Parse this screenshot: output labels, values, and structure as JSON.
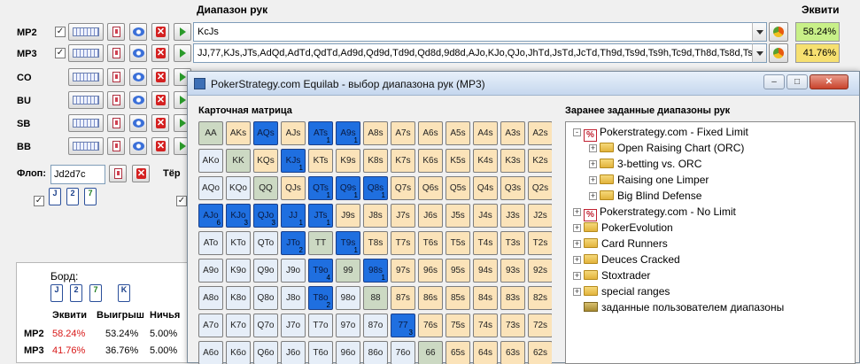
{
  "main": {
    "range_header": "Диапазон рук",
    "equity_header": "Эквити",
    "players": [
      {
        "label": "MP2",
        "checked": "✓",
        "range": "KcJs",
        "equity": "58.24%",
        "equity_color": "#c8f088"
      },
      {
        "label": "MP3",
        "checked": "✓",
        "range": "JJ,77,KJs,JTs,AdQd,AdTd,QdTd,Ad9d,Qd9d,Td9d,Qd8d,9d8d,AJo,KJo,QJo,JhTd,JsTd,JcTd,Th9d,Ts9d,Ts9h,Tc9d,Th8d,Ts8d,Ts",
        "equity": "41.76%",
        "equity_color": "#f6e070"
      },
      {
        "label": "CO"
      },
      {
        "label": "BU"
      },
      {
        "label": "SB"
      },
      {
        "label": "BB"
      }
    ],
    "flop_label": "Флоп:",
    "flop_value": "Jd2d7c",
    "turn_label": "Тёр",
    "flop_cards": [
      "J",
      "2",
      "7"
    ],
    "flop_check": "✓",
    "turn_check": "✓"
  },
  "results": {
    "board_label": "Борд:",
    "board_cards": [
      "J",
      "2",
      "7",
      "K"
    ],
    "col_equity": "Эквити",
    "col_win": "Выигрыш",
    "col_tie": "Ничья",
    "rows": [
      {
        "player": "MP2",
        "equity": "58.24%",
        "win": "53.24%",
        "tie": "5.00%"
      },
      {
        "player": "MP3",
        "equity": "41.76%",
        "win": "36.76%",
        "tie": "5.00%"
      }
    ],
    "equity_text_color": "#d81818"
  },
  "dialog": {
    "title": "PokerStrategy.com Equilab - выбор диапазона рук (MP3)",
    "min_glyph": "–",
    "max_glyph": "□",
    "close_glyph": "✕",
    "matrix_title": "Карточная матрица",
    "preset_title": "Заранее заданные диапазоны рук",
    "matrix_rows": [
      [
        "AA",
        "AKs",
        "AQs",
        "AJs",
        "ATs",
        "A9s",
        "A8s",
        "A7s",
        "A6s",
        "A5s",
        "A4s",
        "A3s",
        "A2s"
      ],
      [
        "AKo",
        "KK",
        "KQs",
        "KJs",
        "KTs",
        "K9s",
        "K8s",
        "K7s",
        "K6s",
        "K5s",
        "K4s",
        "K3s",
        "K2s"
      ],
      [
        "AQo",
        "KQo",
        "QQ",
        "QJs",
        "QTs",
        "Q9s",
        "Q8s",
        "Q7s",
        "Q6s",
        "Q5s",
        "Q4s",
        "Q3s",
        "Q2s"
      ],
      [
        "AJo",
        "KJo",
        "QJo",
        "JJ",
        "JTs",
        "J9s",
        "J8s",
        "J7s",
        "J6s",
        "J5s",
        "J4s",
        "J3s",
        "J2s"
      ],
      [
        "ATo",
        "KTo",
        "QTo",
        "JTo",
        "TT",
        "T9s",
        "T8s",
        "T7s",
        "T6s",
        "T5s",
        "T4s",
        "T3s",
        "T2s"
      ],
      [
        "A9o",
        "K9o",
        "Q9o",
        "J9o",
        "T9o",
        "99",
        "98s",
        "97s",
        "96s",
        "95s",
        "94s",
        "93s",
        "92s"
      ],
      [
        "A8o",
        "K8o",
        "Q8o",
        "J8o",
        "T8o",
        "98o",
        "88",
        "87s",
        "86s",
        "85s",
        "84s",
        "83s",
        "82s"
      ],
      [
        "A7o",
        "K7o",
        "Q7o",
        "J7o",
        "T7o",
        "97o",
        "87o",
        "77",
        "76s",
        "75s",
        "74s",
        "73s",
        "72s"
      ],
      [
        "A6o",
        "K6o",
        "Q6o",
        "J6o",
        "T6o",
        "96o",
        "86o",
        "76o",
        "66",
        "65s",
        "64s",
        "63s",
        "62s"
      ]
    ],
    "selected_cells": {
      "AQs": "",
      "ATs": "1",
      "A9s": "1",
      "KJs": "1",
      "QTs": "1",
      "Q9s": "1",
      "Q8s": "1",
      "AJo": "6",
      "KJo": "3",
      "QJo": "3",
      "JJ": "1",
      "JTs": "1",
      "JTo": "2",
      "T9s": "1",
      "T9o": "4",
      "98s": "1",
      "T8o": "2",
      "77": "3"
    },
    "tree": [
      {
        "level": 0,
        "kind": "ps",
        "expander": "-",
        "label": "Pokerstrategy.com - Fixed Limit"
      },
      {
        "level": 1,
        "kind": "folder",
        "expander": "+",
        "label": "Open Raising Chart (ORC)"
      },
      {
        "level": 1,
        "kind": "folder",
        "expander": "+",
        "label": "3-betting vs. ORC"
      },
      {
        "level": 1,
        "kind": "folder",
        "expander": "+",
        "label": "Raising one Limper"
      },
      {
        "level": 1,
        "kind": "folder",
        "expander": "+",
        "label": "Big Blind Defense"
      },
      {
        "level": 0,
        "kind": "ps",
        "expander": "+",
        "label": "Pokerstrategy.com - No Limit"
      },
      {
        "level": 0,
        "kind": "folder",
        "expander": "+",
        "label": "PokerEvolution"
      },
      {
        "level": 0,
        "kind": "folder",
        "expander": "+",
        "label": "Card Runners"
      },
      {
        "level": 0,
        "kind": "folder",
        "expander": "+",
        "label": "Deuces Cracked"
      },
      {
        "level": 0,
        "kind": "folder",
        "expander": "+",
        "label": "Stoxtrader"
      },
      {
        "level": 0,
        "kind": "folder",
        "expander": "+",
        "label": "special ranges"
      },
      {
        "level": 0,
        "kind": "user",
        "expander": "",
        "label": "заданные пользователем диапазоны"
      }
    ]
  }
}
